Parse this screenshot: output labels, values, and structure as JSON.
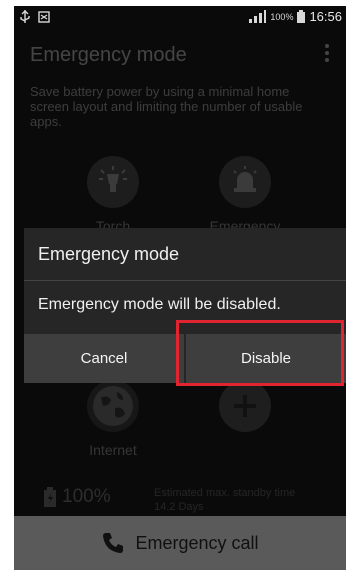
{
  "statusbar": {
    "usb_icon": "usb-icon",
    "notify_icon": "notification-icon",
    "signal_icon": "signal-icon",
    "battery_percent": "100%",
    "time": "16:56"
  },
  "app": {
    "title": "Emergency mode",
    "menu_icon": "overflow-menu-icon",
    "description": "Save battery power by using a minimal home screen layout and limiting the number of usable apps."
  },
  "tiles": [
    {
      "label": "Torch",
      "icon": "torch-icon"
    },
    {
      "label": "Emergency",
      "icon": "emergency-alarm-icon"
    },
    {
      "label": "Internet",
      "icon": "globe-icon"
    },
    {
      "label": "",
      "icon": "add-icon"
    }
  ],
  "battery": {
    "percent": "100%",
    "standby_label": "Estimated max. standby time",
    "standby_value": "14.2 Days"
  },
  "dialog": {
    "title": "Emergency mode",
    "message": "Emergency mode will be disabled.",
    "cancel_label": "Cancel",
    "disable_label": "Disable"
  },
  "callbar": {
    "label": "Emergency call",
    "icon": "phone-icon"
  },
  "colors": {
    "highlight": "#e02530",
    "dialog_bg": "#262626",
    "button_bg": "#3e3e3e"
  }
}
